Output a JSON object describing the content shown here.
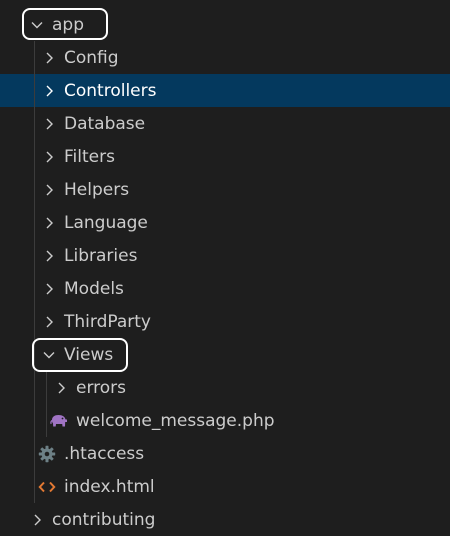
{
  "explorer": {
    "root": {
      "label": "app",
      "expanded": true,
      "highlighted": true
    },
    "folders": [
      {
        "label": "Config"
      },
      {
        "label": "Controllers",
        "selected": true
      },
      {
        "label": "Database"
      },
      {
        "label": "Filters"
      },
      {
        "label": "Helpers"
      },
      {
        "label": "Language"
      },
      {
        "label": "Libraries"
      },
      {
        "label": "Models"
      },
      {
        "label": "ThirdParty"
      }
    ],
    "views": {
      "label": "Views",
      "expanded": true,
      "highlighted": true,
      "children": [
        {
          "label": "errors",
          "type": "folder"
        },
        {
          "label": "welcome_message.php",
          "type": "file",
          "icon": "php-elephant-icon"
        }
      ]
    },
    "files": [
      {
        "label": ".htaccess",
        "icon": "gear-icon"
      },
      {
        "label": "index.html",
        "icon": "html-brackets-icon"
      }
    ],
    "next_partial": {
      "label": "contributing"
    }
  },
  "colors": {
    "background": "#1e1e1e",
    "selection": "#04395e",
    "text": "#cccccc",
    "selected_text": "#ffffff",
    "highlight_outline": "#ffffff",
    "php_icon": "#a074c4",
    "gear_icon": "#6d8086",
    "html_icon": "#e37933"
  }
}
